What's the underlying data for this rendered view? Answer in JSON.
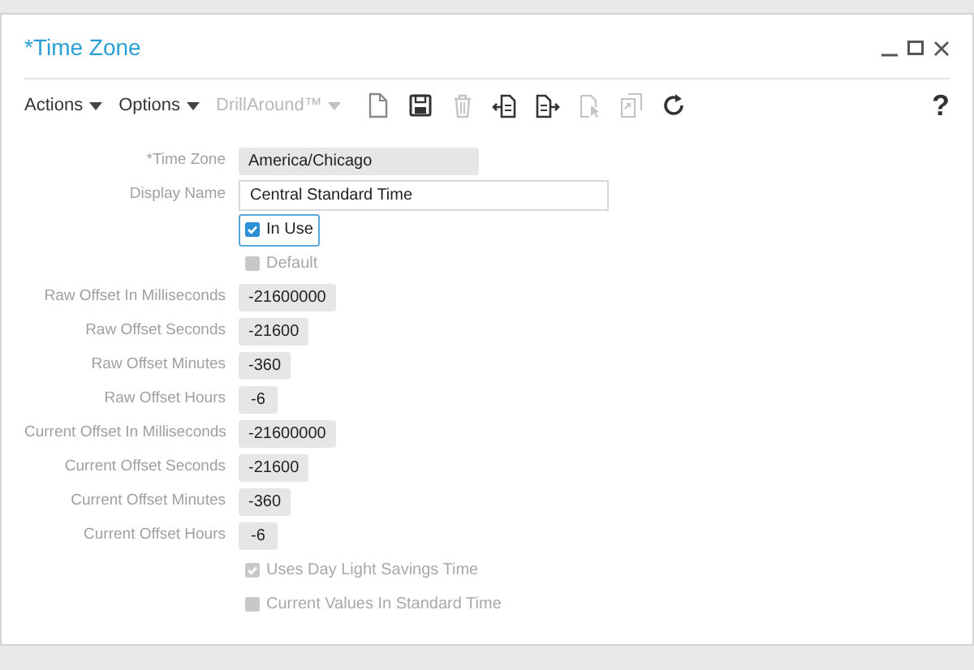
{
  "window": {
    "title": "*Time Zone"
  },
  "toolbar": {
    "menus": [
      {
        "label": "Actions",
        "disabled": false
      },
      {
        "label": "Options",
        "disabled": false
      },
      {
        "label": "DrillAround™",
        "disabled": true
      }
    ],
    "icons": [
      {
        "kind": "document",
        "disabled": false
      },
      {
        "kind": "save",
        "disabled": false
      },
      {
        "kind": "trash",
        "disabled": true
      },
      {
        "kind": "import",
        "disabled": false
      },
      {
        "kind": "export",
        "disabled": false
      },
      {
        "kind": "pointer",
        "disabled": true
      },
      {
        "kind": "copy",
        "disabled": true
      },
      {
        "kind": "refresh",
        "disabled": false
      }
    ],
    "help": "?"
  },
  "form": [
    {
      "kind": "readonly",
      "label": "*Time Zone",
      "value": "America/Chicago",
      "wide": true
    },
    {
      "kind": "input",
      "label": "Display Name",
      "value": "Central Standard Time"
    },
    {
      "kind": "checkbox",
      "label": "In Use",
      "checked": true,
      "disabled": false,
      "focused": true
    },
    {
      "kind": "checkbox",
      "label": "Default",
      "checked": false,
      "disabled": true,
      "focused": false
    },
    {
      "kind": "readonly",
      "label": "Raw Offset In Milliseconds",
      "value": "-21600000"
    },
    {
      "kind": "readonly",
      "label": "Raw Offset Seconds",
      "value": "-21600"
    },
    {
      "kind": "readonly",
      "label": "Raw Offset Minutes",
      "value": "-360"
    },
    {
      "kind": "readonly",
      "label": "Raw Offset Hours",
      "value": "-6"
    },
    {
      "kind": "readonly",
      "label": "Current Offset In Milliseconds",
      "value": "-21600000"
    },
    {
      "kind": "readonly",
      "label": "Current Offset Seconds",
      "value": "-21600"
    },
    {
      "kind": "readonly",
      "label": "Current Offset Minutes",
      "value": "-360"
    },
    {
      "kind": "readonly",
      "label": "Current Offset Hours",
      "value": "-6"
    },
    {
      "kind": "checkbox",
      "label": "Uses Day Light Savings Time",
      "checked": true,
      "disabled": true,
      "focused": false
    },
    {
      "kind": "checkbox",
      "label": "Current Values In Standard Time",
      "checked": false,
      "disabled": true,
      "focused": false
    }
  ]
}
